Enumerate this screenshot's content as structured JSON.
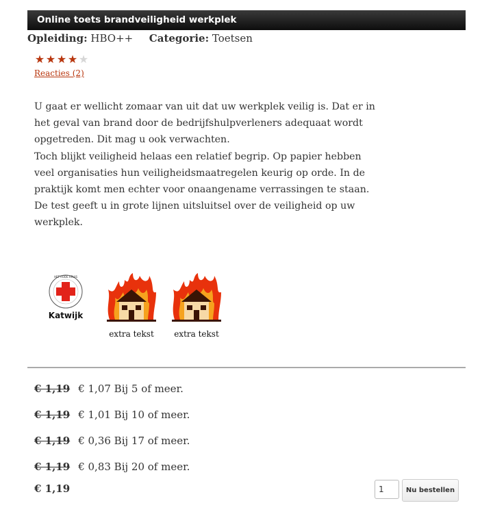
{
  "title": "Online toets brandveiligheid werkplek",
  "meta": {
    "opleiding_label": "Opleiding:",
    "opleiding_value": "HBO++",
    "categorie_label": "Categorie:",
    "categorie_value": "Toetsen"
  },
  "rating": {
    "value": 4,
    "max": 5
  },
  "reviews_link": "Reacties (2)",
  "description": {
    "p1": "U gaat er wellicht zomaar van uit dat uw werkplek veilig is. Dat er in het geval van brand door de bedrijfshulpverleners adequaat wordt opgetreden. Dit mag u ook verwachten.",
    "p2": "Toch blijkt veiligheid helaas een relatief begrip. Op papier hebben veel organisaties hun veiligheidsmaatregelen keurig op orde. In de praktijk komt men echter voor onaangename verrassingen te staan. De test geeft u in grote lijnen uitsluitsel over de veiligheid op uw werkplek."
  },
  "logos": {
    "red_cross_ring": "HET RODE KRUIS · EHBO · KATWIJK",
    "red_cross_city": "Katwijk",
    "fire_1_caption": "extra tekst",
    "fire_2_caption": "extra tekst"
  },
  "prices": [
    {
      "old": "€ 1,19",
      "new": "€ 1,07 Bij 5 of meer."
    },
    {
      "old": "€ 1,19",
      "new": "€ 1,01 Bij 10 of meer."
    },
    {
      "old": "€ 1,19",
      "new": "€ 0,36 Bij 17 of meer."
    },
    {
      "old": "€ 1,19",
      "new": "€ 0,83 Bij 20 of meer."
    }
  ],
  "final_price": "€ 1,19",
  "order": {
    "quantity": "1",
    "button_label": "Nu bestellen"
  },
  "colors": {
    "accent": "#b8360e",
    "title_bar": "#1a1a1a"
  }
}
